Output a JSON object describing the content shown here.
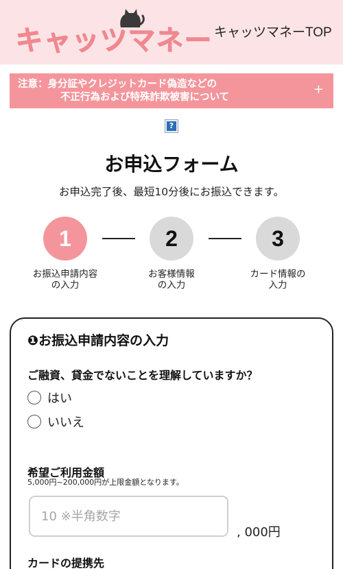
{
  "header": {
    "logo_text": "キャッツマネー",
    "top_link": "キャッツマネーTOP",
    "colors": {
      "background": "#fce4e6",
      "logo": "#f0888f"
    }
  },
  "notice": {
    "line1": "注意：身分証やクレジットカード偽造などの",
    "line2": "不正行為および特殊詐欺被害について",
    "toggle": "+",
    "color": "#f4959c"
  },
  "help_icon": {
    "glyph": "?"
  },
  "form_header": {
    "title": "お申込フォーム",
    "subtitle": "お申込完了後、最短10分後にお振込できます。"
  },
  "steps": [
    {
      "number": "1",
      "label_line1": "お振込申請内容",
      "label_line2": "の入力",
      "active": true
    },
    {
      "number": "2",
      "label_line1": "お客様情報",
      "label_line2": "の入力",
      "active": false
    },
    {
      "number": "3",
      "label_line1": "カード情報の",
      "label_line2": "入力",
      "active": false
    }
  ],
  "form": {
    "section_title": "❶お振込申請内容の入力",
    "question": "ご融資、貸金でないことを理解していますか？",
    "options": [
      {
        "label": "はい",
        "checked": false
      },
      {
        "label": "いいえ",
        "checked": false
      }
    ],
    "amount": {
      "label": "希望ご利用金額",
      "note": "5,000円~200,000円が上限金額となります。",
      "placeholder": "10 ※半角数字",
      "value": "",
      "unit": ", 000円"
    },
    "card_label": "カードの提携先"
  }
}
